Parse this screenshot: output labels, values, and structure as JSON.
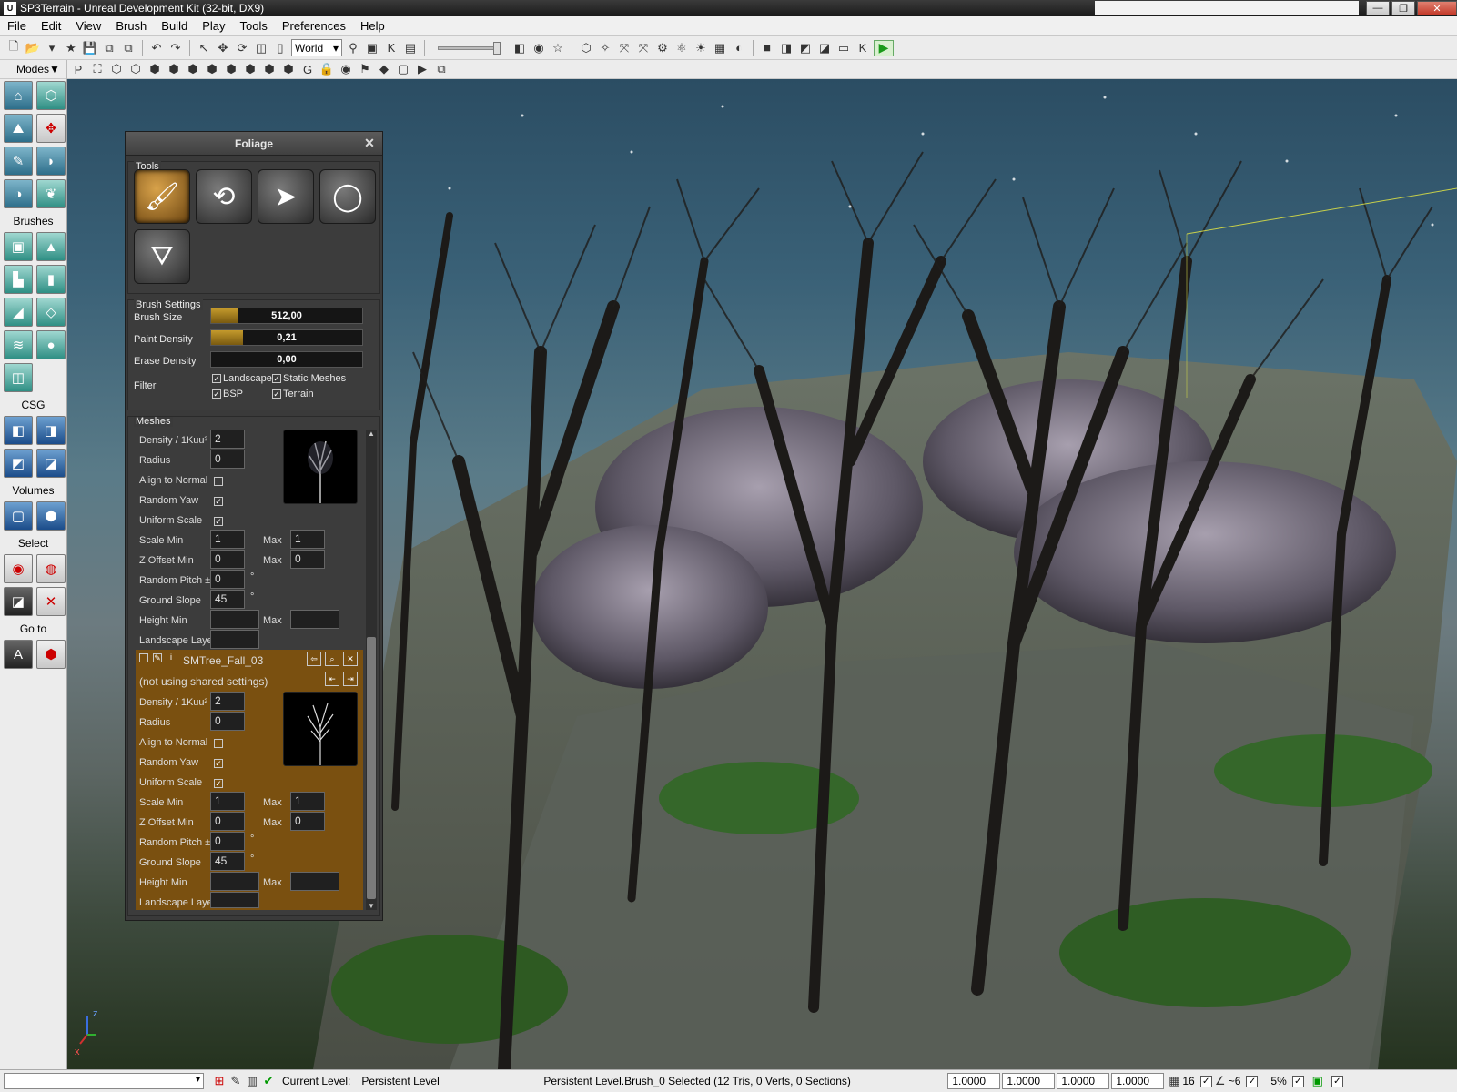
{
  "window": {
    "title": "SP3Terrain - Unreal Development Kit (32-bit, DX9)"
  },
  "menu": [
    "File",
    "Edit",
    "View",
    "Brush",
    "Build",
    "Play",
    "Tools",
    "Preferences",
    "Help"
  ],
  "toolbar": {
    "coordinate_system": "World"
  },
  "modes": {
    "header": "Modes",
    "brushes": "Brushes",
    "csg": "CSG",
    "volumes": "Volumes",
    "select": "Select",
    "goto": "Go to"
  },
  "foliage": {
    "title": "Foliage",
    "tools_label": "Tools",
    "brush_settings_label": "Brush Settings",
    "brush_size_label": "Brush Size",
    "brush_size_value": "512,00",
    "brush_size_fraction": 0.18,
    "paint_density_label": "Paint Density",
    "paint_density_value": "0,21",
    "paint_density_fraction": 0.21,
    "erase_density_label": "Erase Density",
    "erase_density_value": "0,00",
    "filter_label": "Filter",
    "filter_landscape": "Landscape",
    "filter_static_meshes": "Static Meshes",
    "filter_bsp": "BSP",
    "filter_terrain": "Terrain",
    "meshes_label": "Meshes",
    "mesh1": {
      "density_label": "Density / 1Kuu²",
      "density": "2",
      "radius_label": "Radius",
      "radius": "0",
      "align_label": "Align to Normal",
      "random_yaw_label": "Random Yaw",
      "uniform_scale_label": "Uniform Scale",
      "scale_min_label": "Scale Min",
      "scale_min": "1",
      "max_label": "Max",
      "scale_max": "1",
      "zoffset_label": "Z Offset Min",
      "zoffset_min": "0",
      "zoffset_max": "0",
      "random_pitch_label": "Random Pitch ±",
      "random_pitch": "0",
      "deg": "°",
      "ground_slope_label": "Ground Slope",
      "ground_slope": "45",
      "height_min_label": "Height Min",
      "landscape_layer_label": "Landscape Layer"
    },
    "mesh2": {
      "name": "SMTree_Fall_03",
      "shared_note": "(not using shared settings)",
      "density_label": "Density / 1Kuu²",
      "density": "2",
      "radius_label": "Radius",
      "radius": "0",
      "align_label": "Align to Normal",
      "random_yaw_label": "Random Yaw",
      "uniform_scale_label": "Uniform Scale",
      "scale_min_label": "Scale Min",
      "scale_min": "1",
      "max_label": "Max",
      "scale_max": "1",
      "zoffset_label": "Z Offset Min",
      "zoffset_min": "0",
      "zoffset_max": "0",
      "random_pitch_label": "Random Pitch ±",
      "random_pitch": "0",
      "deg": "°",
      "ground_slope_label": "Ground Slope",
      "ground_slope": "45",
      "height_min_label": "Height Min",
      "landscape_layer_label": "Landscape Layer"
    }
  },
  "status": {
    "current_level_label": "Current Level:",
    "current_level": "Persistent Level",
    "selection": "Persistent Level.Brush_0 Selected (12 Tris, 0 Verts, 0 Sections)",
    "scale_x": "1.0000",
    "scale_y": "1.0000",
    "scale_z": "1.0000",
    "scale_all": "1.0000",
    "grid": "16",
    "rotation_snap": "~6",
    "scale_snap": "5%"
  },
  "axis": {
    "z": "z",
    "x": "x"
  }
}
